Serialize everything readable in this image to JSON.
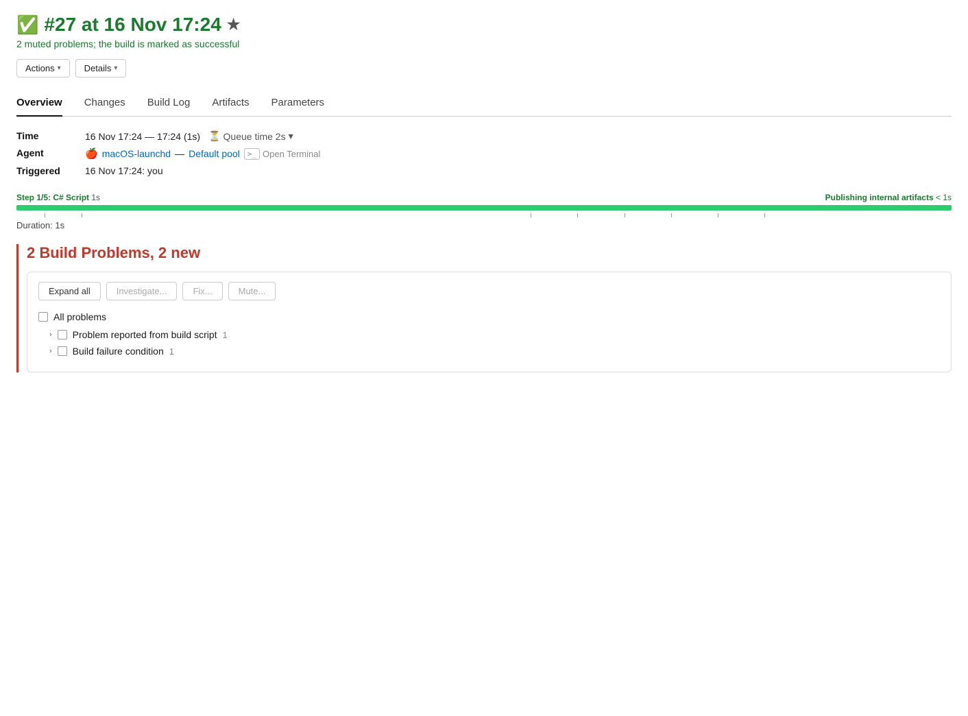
{
  "header": {
    "build_number": "#27 at 16 Nov 17:24",
    "subtitle": "2 muted problems; the build is marked as successful",
    "actions_label": "Actions",
    "details_label": "Details"
  },
  "tabs": [
    {
      "id": "overview",
      "label": "Overview",
      "active": true
    },
    {
      "id": "changes",
      "label": "Changes",
      "active": false
    },
    {
      "id": "build-log",
      "label": "Build Log",
      "active": false
    },
    {
      "id": "artifacts",
      "label": "Artifacts",
      "active": false
    },
    {
      "id": "parameters",
      "label": "Parameters",
      "active": false
    }
  ],
  "build_info": {
    "time_label": "Time",
    "time_value": "16 Nov 17:24 — 17:24 (1s)",
    "queue_time": "Queue time 2s",
    "agent_label": "Agent",
    "agent_name": "macOS-launchd",
    "agent_pool": "Default pool",
    "open_terminal": "Open Terminal",
    "triggered_label": "Triggered",
    "triggered_value": "16 Nov 17:24: you"
  },
  "timeline": {
    "step_label": "Step 1/5: C# Script",
    "step_duration": "1s",
    "publish_label": "Publishing internal artifacts",
    "publish_duration": "< 1s",
    "duration_label": "Duration: 1s",
    "bar_width_pct": 100
  },
  "problems": {
    "title": "2 Build Problems, 2 new",
    "actions": {
      "expand_all": "Expand all",
      "investigate": "Investigate...",
      "fix": "Fix...",
      "mute": "Mute..."
    },
    "all_label": "All problems",
    "items": [
      {
        "label": "Problem reported from build script",
        "count": "1"
      },
      {
        "label": "Build failure condition",
        "count": "1"
      }
    ]
  },
  "icons": {
    "check": "✅",
    "star": "★",
    "hourglass": "⏳",
    "apple": "",
    "chevron_down": "▾",
    "chevron_right": "›",
    "terminal": ">_"
  }
}
